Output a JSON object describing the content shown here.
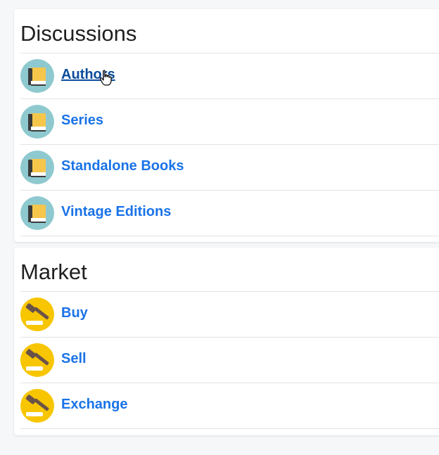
{
  "discussions": {
    "title": "Discussions",
    "items": [
      {
        "label": "Authors",
        "icon": "book-icon"
      },
      {
        "label": "Series",
        "icon": "book-icon"
      },
      {
        "label": "Standalone Books",
        "icon": "book-icon"
      },
      {
        "label": "Vintage Editions",
        "icon": "book-icon"
      }
    ]
  },
  "market": {
    "title": "Market",
    "items": [
      {
        "label": "Buy",
        "icon": "gavel-icon"
      },
      {
        "label": "Sell",
        "icon": "gavel-icon"
      },
      {
        "label": "Exchange",
        "icon": "gavel-icon"
      }
    ]
  },
  "colors": {
    "link": "#1a73e8",
    "link_hover": "#0b4c9c",
    "book_avatar_bg": "#8ec9cf",
    "gavel_avatar_bg": "#f7c600"
  }
}
